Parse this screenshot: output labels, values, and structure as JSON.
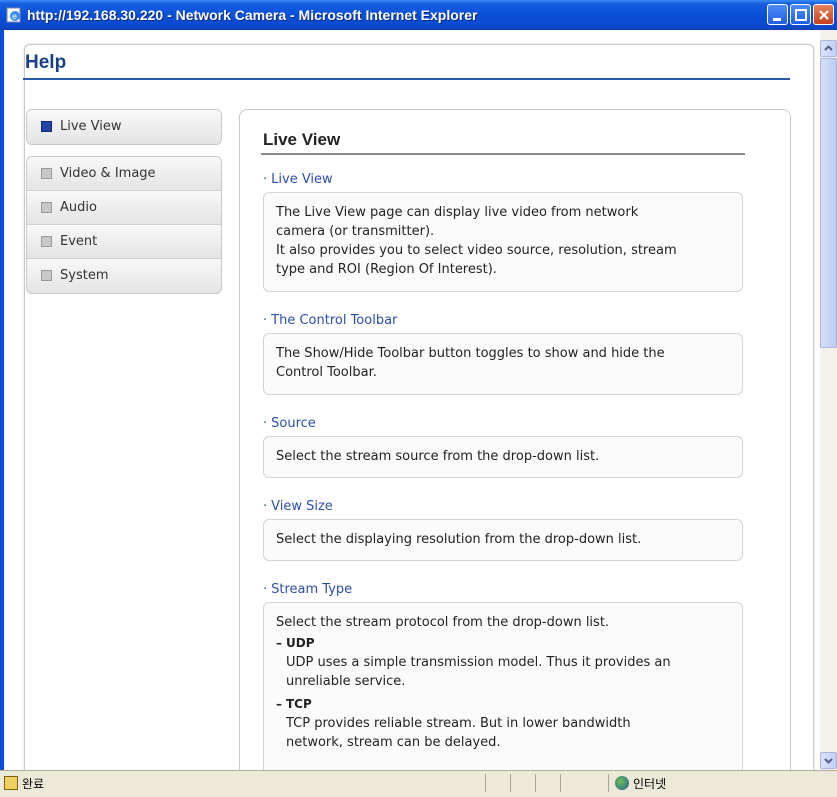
{
  "window": {
    "title": "http://192.168.30.220 - Network Camera - Microsoft Internet Explorer"
  },
  "help": {
    "title": "Help"
  },
  "nav": {
    "active": {
      "label": "Live View"
    },
    "items": [
      {
        "label": "Video & Image"
      },
      {
        "label": "Audio"
      },
      {
        "label": "Event"
      },
      {
        "label": "System"
      }
    ]
  },
  "main": {
    "title": "Live View",
    "sections": [
      {
        "heading": "Live View",
        "lines": [
          "The Live View page can display live video from network",
          "camera (or transmitter).",
          "It also provides you to select video source, resolution, stream",
          "type and ROI (Region Of Interest)."
        ]
      },
      {
        "heading": "The Control Toolbar",
        "lines": [
          "The Show/Hide Toolbar button toggles to show and hide the",
          "Control Toolbar."
        ]
      },
      {
        "heading": "Source",
        "lines": [
          "Select the stream source from the drop-down list."
        ]
      },
      {
        "heading": "View Size",
        "lines": [
          "Select the displaying resolution from the drop-down list."
        ]
      },
      {
        "heading": "Stream Type",
        "intro": "Select the stream protocol from the drop-down list.",
        "subitems": [
          {
            "label": "UDP",
            "lines": [
              "UDP uses a simple transmission model. Thus it provides an",
              "unreliable service."
            ]
          },
          {
            "label": "TCP",
            "lines": [
              "TCP provides reliable stream. But in lower bandwidth",
              "network, stream can be delayed."
            ]
          }
        ]
      }
    ]
  },
  "statusbar": {
    "status": "완료",
    "zone": "인터넷"
  },
  "colors": {
    "titlebar": "#0a4fd8",
    "help_title": "#1b3f87",
    "section_heading": "#2b4fa8",
    "nav_active_icon": "#1e44a8"
  }
}
